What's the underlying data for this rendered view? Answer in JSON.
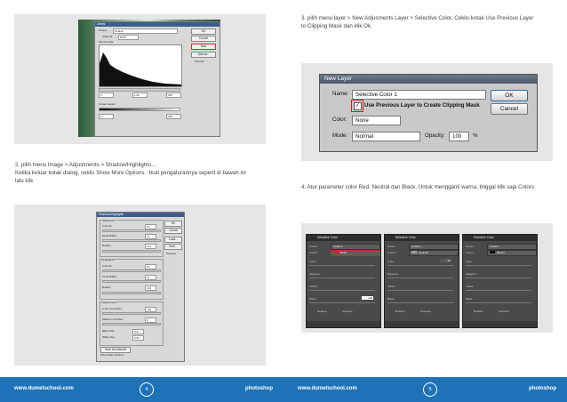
{
  "left_page": {
    "caption_line1": "2. pilih menu Image > Adjustments > Shadow/Highlights…",
    "caption_line2": "Ketika keluar kotak dialog, ceklis Show More Options . Ikuti pengaturannya seperti di bawah ini",
    "caption_line3": "lalu klik",
    "footer_site": "www.dumetschool.com",
    "footer_page": "4",
    "footer_topic": "photoshop",
    "levels_dialog": {
      "title": "Levels",
      "preset_label": "Preset:",
      "preset_value": "Default",
      "channel_label": "Channel:",
      "channel_value": "RGB",
      "input_label": "Input Levels:",
      "input_values": [
        "0",
        "1,00",
        "255"
      ],
      "output_label": "Output Levels:",
      "output_values": [
        "0",
        "255"
      ],
      "buttons": [
        "OK",
        "Cancel",
        "Auto",
        "Options..."
      ],
      "preview_label": "Preview"
    },
    "shadow_dialog": {
      "title": "Shadows/Highlights",
      "shadows_label": "Shadows",
      "highlights_label": "Highlights",
      "adjustments_label": "Adjustments",
      "amount_label": "Amount:",
      "tonal_width_label": "Tonal Width:",
      "radius_label": "Radius:",
      "shadow_values": [
        "10",
        "10",
        "114"
      ],
      "highlight_values": [
        "10",
        "16",
        "130"
      ],
      "color_correction_label": "Color Correction:",
      "color_correction_value": "+20",
      "midtone_label": "Midtone Contrast:",
      "midtone_value": "0",
      "black_clip_label": "Black Clip:",
      "black_clip_value": "0,01",
      "white_clip_label": "White Clip:",
      "white_clip_value": "0,01",
      "save_default": "Save As Defaults",
      "show_more": "Show More Options",
      "buttons": [
        "OK",
        "Cancel",
        "Load...",
        "Save..."
      ],
      "preview_label": "Preview"
    }
  },
  "right_page": {
    "caption3_line1": "3. pilih menu layer > New Adjusments Layer > Selective Color, Ceklis kotak Use Previous Layer",
    "caption3_line2": "to Clipping Mask dan klik Ok.",
    "caption4": "4. Atur parameter color Red, Neutral dan Black, Untuk mengganti warna, tinggal klik saja Colors",
    "footer_site": "www.dumetschool.com",
    "footer_page": "5",
    "footer_topic": "photoshop",
    "new_layer": {
      "title": "New Layer",
      "name_label": "Name:",
      "name_value": "Selective Color 1",
      "clip_label": "Use Previous Layer to Create Clipping Mask",
      "color_label": "Color:",
      "color_value": "None",
      "mode_label": "Mode:",
      "mode_value": "Normal",
      "opacity_label": "Opacity:",
      "opacity_value": "100",
      "opacity_unit": "%",
      "ok": "OK",
      "cancel": "Cancel"
    },
    "panels": [
      {
        "title": "Selective Color",
        "preset": "Custom",
        "colors": "Reds",
        "swatch": "#c62828",
        "cyan": "",
        "magenta": "",
        "yellow": "",
        "black": "+68"
      },
      {
        "title": "Selective Color",
        "preset": "Custom",
        "colors": "Neutrals",
        "swatch": "#9e9e9e",
        "cyan": "-22",
        "magenta": "",
        "yellow": "",
        "black": ""
      },
      {
        "title": "Selective Color",
        "preset": "Custom",
        "colors": "Blacks",
        "swatch": "#111111",
        "cyan": "",
        "magenta": "",
        "yellow": "",
        "black": ""
      }
    ],
    "panel_labels": {
      "preset": "Preset:",
      "colors": "Colors:",
      "cyan": "Cyan:",
      "magenta": "Magenta:",
      "yellow": "Yellow:",
      "black": "Black:",
      "relative": "Relative",
      "absolute": "Absolute"
    }
  }
}
